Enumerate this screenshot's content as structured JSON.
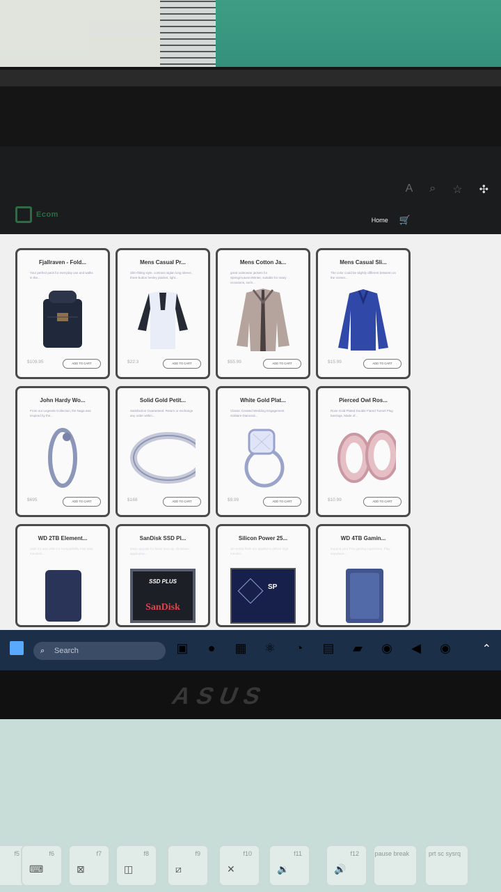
{
  "app": {
    "brand": "Ecom",
    "nav": {
      "home_label": "Home"
    },
    "browser_icons": [
      "read-aloud-icon",
      "zoom-icon",
      "favorite-star-icon",
      "extension-puzzle-icon"
    ]
  },
  "products": [
    {
      "title": "Fjallraven - Fold...",
      "desc": "Your perfect pack for everyday use and walks in the...",
      "price": "$109.95",
      "button": "ADD TO CART",
      "image": "backpack"
    },
    {
      "title": "Mens Casual Pr...",
      "desc": "Slim-fitting style, contrast raglan long sleeve, three-button henley placket, light...",
      "price": "$22.3",
      "button": "ADD TO CART",
      "image": "raglan-shirt"
    },
    {
      "title": "Mens Cotton Ja...",
      "desc": "great outerwear jackets for Spring/Autumn/Winter, suitable for many occasions, such...",
      "price": "$55.99",
      "button": "ADD TO CART",
      "image": "jacket"
    },
    {
      "title": "Mens Casual Sli...",
      "desc": "The color could be slightly different between on the screen...",
      "price": "$15.99",
      "button": "ADD TO CART",
      "image": "blue-shirt"
    },
    {
      "title": "John Hardy Wo...",
      "desc": "From our Legends Collection, the Naga was inspired by the...",
      "price": "$695",
      "button": "ADD TO CART",
      "image": "dragon-bracelet"
    },
    {
      "title": "Solid Gold Petit...",
      "desc": "Satisfaction Guaranteed. Return or exchange any order within...",
      "price": "$168",
      "button": "ADD TO CART",
      "image": "gold-ring"
    },
    {
      "title": "White Gold Plat...",
      "desc": "Classic Created Wedding Engagement Solitaire Diamond...",
      "price": "$9.99",
      "button": "ADD TO CART",
      "image": "diamond-ring"
    },
    {
      "title": "Pierced Owl Ros...",
      "desc": "Rose Gold Plated Double Flared Tunnel Plug Earrings. Made of...",
      "price": "$10.99",
      "button": "ADD TO CART",
      "image": "rose-plugs"
    },
    {
      "title": "WD 2TB Element...",
      "desc": "USB 3.0 and USB 2.0 Compatibility Fast data transfers...",
      "price": "",
      "button": "",
      "image": "wd-drive"
    },
    {
      "title": "SanDisk SSD Pl...",
      "desc": "Easy upgrade for faster boot up, shutdown, application...",
      "price": "",
      "button": "",
      "image": "sandisk-ssd",
      "label_top": "SSD PLUS",
      "label_brand": "SanDisk"
    },
    {
      "title": "Silicon Power 25...",
      "desc": "3D NAND flash are applied to deliver high transfer...",
      "price": "",
      "button": "",
      "image": "sp-ssd",
      "label_brand": "SP"
    },
    {
      "title": "WD 4TB Gamin...",
      "desc": "Expand your PS4 gaming experience, Play anywhere...",
      "price": "",
      "button": "",
      "image": "wd-4tb"
    }
  ],
  "taskbar": {
    "search_placeholder": "Search",
    "icons": [
      "task-view-icon",
      "chat-icon",
      "calendar-icon",
      "react-icon",
      "edge-browser-icon",
      "notepad-icon",
      "file-explorer-icon",
      "chrome-icon",
      "vscode-icon",
      "chrome-icon"
    ]
  },
  "laptop_brand": "ASUS",
  "keys": [
    {
      "label": "f5",
      "icon": ""
    },
    {
      "label": "f6",
      "icon": "⌨"
    },
    {
      "label": "f7",
      "icon": "⊠"
    },
    {
      "label": "f8",
      "icon": "◫"
    },
    {
      "label": "f9",
      "icon": "⧄"
    },
    {
      "label": "f10",
      "icon": "✕"
    },
    {
      "label": "f11",
      "icon": "🔉"
    },
    {
      "label": "f12",
      "icon": "🔊"
    },
    {
      "label": "pause break",
      "icon": ""
    },
    {
      "label": "prt sc sysrq",
      "icon": ""
    }
  ]
}
